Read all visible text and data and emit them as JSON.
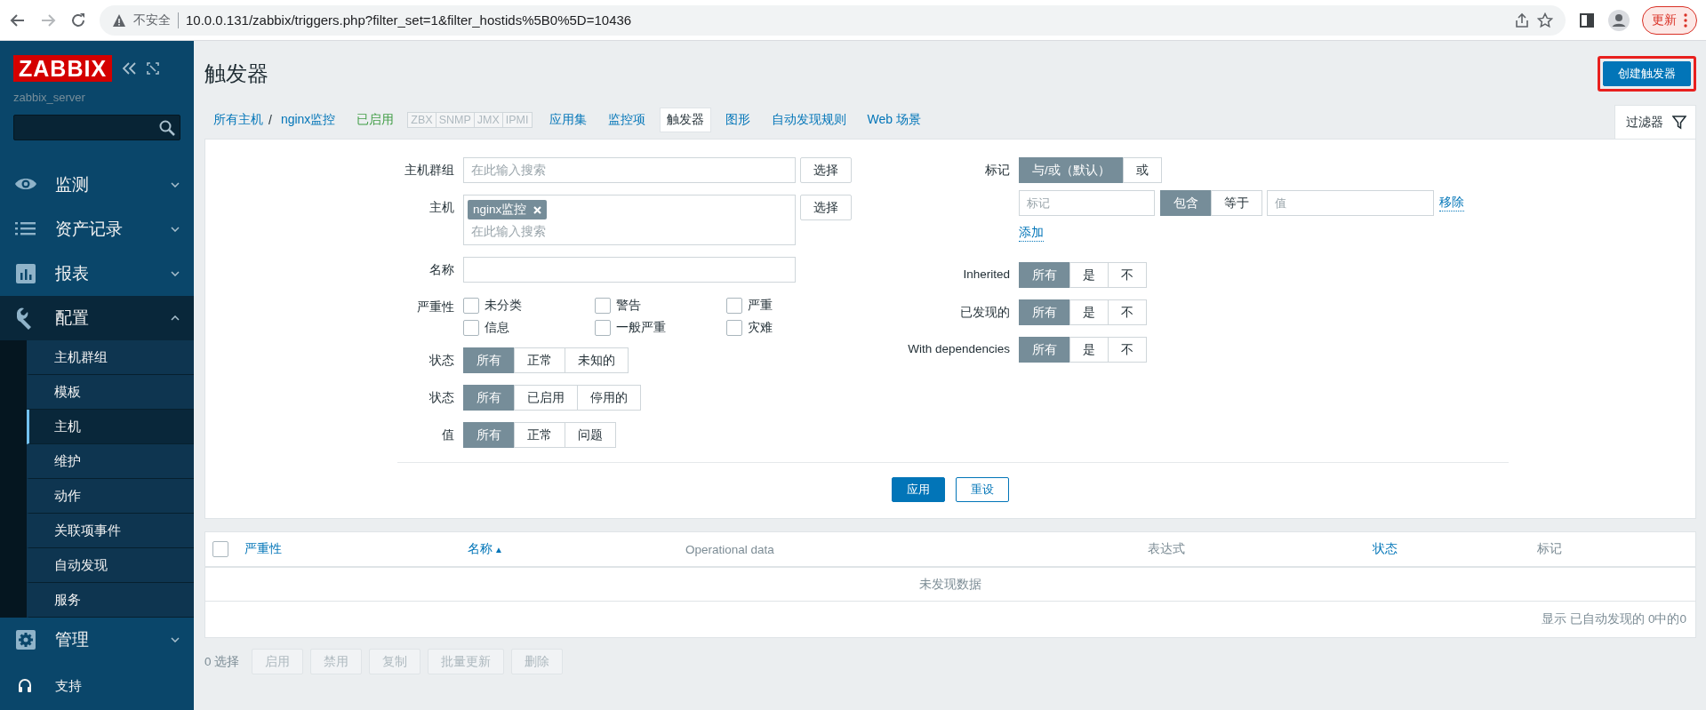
{
  "browser": {
    "security_label": "不安全",
    "url": "10.0.0.131/zabbix/triggers.php?filter_set=1&filter_hostids%5B0%5D=10436",
    "update_button": "更新"
  },
  "sidebar": {
    "logo": "ZABBIX",
    "server_name": "zabbix_server",
    "menu": [
      {
        "label": "监测",
        "expanded": false
      },
      {
        "label": "资产记录",
        "expanded": false
      },
      {
        "label": "报表",
        "expanded": false
      },
      {
        "label": "配置",
        "expanded": true,
        "children": [
          {
            "label": "主机群组",
            "selected": false
          },
          {
            "label": "模板",
            "selected": false
          },
          {
            "label": "主机",
            "selected": true
          },
          {
            "label": "维护",
            "selected": false
          },
          {
            "label": "动作",
            "selected": false
          },
          {
            "label": "关联项事件",
            "selected": false
          },
          {
            "label": "自动发现",
            "selected": false
          },
          {
            "label": "服务",
            "selected": false
          }
        ]
      },
      {
        "label": "管理",
        "expanded": false
      }
    ],
    "support": "支持"
  },
  "header": {
    "title": "触发器",
    "create_button": "创建触发器",
    "create_highlighted": true
  },
  "host_nav": {
    "breadcrumbs": [
      "所有主机",
      "nginx监控"
    ],
    "separator": "/",
    "status": "已启用",
    "interfaces": [
      "ZBX",
      "SNMP",
      "JMX",
      "IPMI"
    ],
    "tabs": [
      {
        "label": "应用集",
        "selected": false
      },
      {
        "label": "监控项",
        "selected": false
      },
      {
        "label": "触发器",
        "selected": true
      },
      {
        "label": "图形",
        "selected": false
      },
      {
        "label": "自动发现规则",
        "selected": false
      },
      {
        "label": "Web 场景",
        "selected": false
      }
    ]
  },
  "filter": {
    "tab": {
      "label": "过滤器",
      "selected": true
    },
    "left": [
      {
        "kind": "multiselect",
        "label": "主机群组",
        "placeholder": "在此输入搜索",
        "button": "选择"
      },
      {
        "kind": "multiselect",
        "label": "主机",
        "chips": [
          "nginx监控"
        ],
        "placeholder": "在此输入搜索",
        "button": "选择"
      },
      {
        "kind": "text",
        "label": "名称"
      },
      {
        "kind": "checkboxes",
        "label": "严重性",
        "options": [
          {
            "label": "未分类",
            "checked": false
          },
          {
            "label": "警告",
            "checked": false
          },
          {
            "label": "严重",
            "checked": false
          },
          {
            "label": "信息",
            "checked": false
          },
          {
            "label": "一般严重",
            "checked": false
          },
          {
            "label": "灾难",
            "checked": false
          }
        ]
      },
      {
        "kind": "segmented",
        "label": "状态",
        "options": [
          {
            "label": "所有",
            "selected": true
          },
          {
            "label": "正常",
            "selected": false
          },
          {
            "label": "未知的",
            "selected": false
          }
        ]
      },
      {
        "kind": "segmented",
        "label": "状态",
        "options": [
          {
            "label": "所有",
            "selected": true
          },
          {
            "label": "已启用",
            "selected": false
          },
          {
            "label": "停用的",
            "selected": false
          }
        ]
      },
      {
        "kind": "segmented",
        "label": "值",
        "options": [
          {
            "label": "所有",
            "selected": true
          },
          {
            "label": "正常",
            "selected": false
          },
          {
            "label": "问题",
            "selected": false
          }
        ]
      }
    ],
    "right": [
      {
        "kind": "tags",
        "label": "标记",
        "options": [
          {
            "label": "与/或（默认）",
            "selected": true
          },
          {
            "label": "或",
            "selected": false
          }
        ],
        "tag_placeholder": "标记",
        "operators": [
          {
            "label": "包含",
            "selected": true
          },
          {
            "label": "等于",
            "selected": false
          }
        ],
        "value_placeholder": "值",
        "remove": "移除",
        "add": "添加"
      },
      {
        "kind": "segmented",
        "label": "Inherited",
        "options": [
          {
            "label": "所有",
            "selected": true
          },
          {
            "label": "是",
            "selected": false
          },
          {
            "label": "不",
            "selected": false
          }
        ]
      },
      {
        "kind": "segmented",
        "label": "已发现的",
        "options": [
          {
            "label": "所有",
            "selected": true
          },
          {
            "label": "是",
            "selected": false
          },
          {
            "label": "不",
            "selected": false
          }
        ]
      },
      {
        "kind": "segmented",
        "label": "With dependencies",
        "options": [
          {
            "label": "所有",
            "selected": true
          },
          {
            "label": "是",
            "selected": false
          },
          {
            "label": "不",
            "selected": false
          }
        ]
      }
    ],
    "apply": "应用",
    "reset": "重设"
  },
  "table": {
    "select_all_checked": false,
    "columns": [
      {
        "label": "严重性",
        "kind": "link"
      },
      {
        "label": "名称",
        "kind": "sorted",
        "sort_arrow": "▲"
      },
      {
        "label": "Operational data",
        "kind": "plain"
      },
      {
        "label": "表达式",
        "kind": "plain"
      },
      {
        "label": "状态",
        "kind": "link"
      },
      {
        "label": "标记",
        "kind": "plain"
      }
    ],
    "empty_text": "未发现数据",
    "footer": "显示 已自动发现的 0中的0"
  },
  "actions": {
    "selected_count": "0 选择",
    "buttons": [
      {
        "label": "启用",
        "disabled": true
      },
      {
        "label": "禁用",
        "disabled": true
      },
      {
        "label": "复制",
        "disabled": true
      },
      {
        "label": "批量更新",
        "disabled": true
      },
      {
        "label": "删除",
        "disabled": true
      }
    ]
  }
}
